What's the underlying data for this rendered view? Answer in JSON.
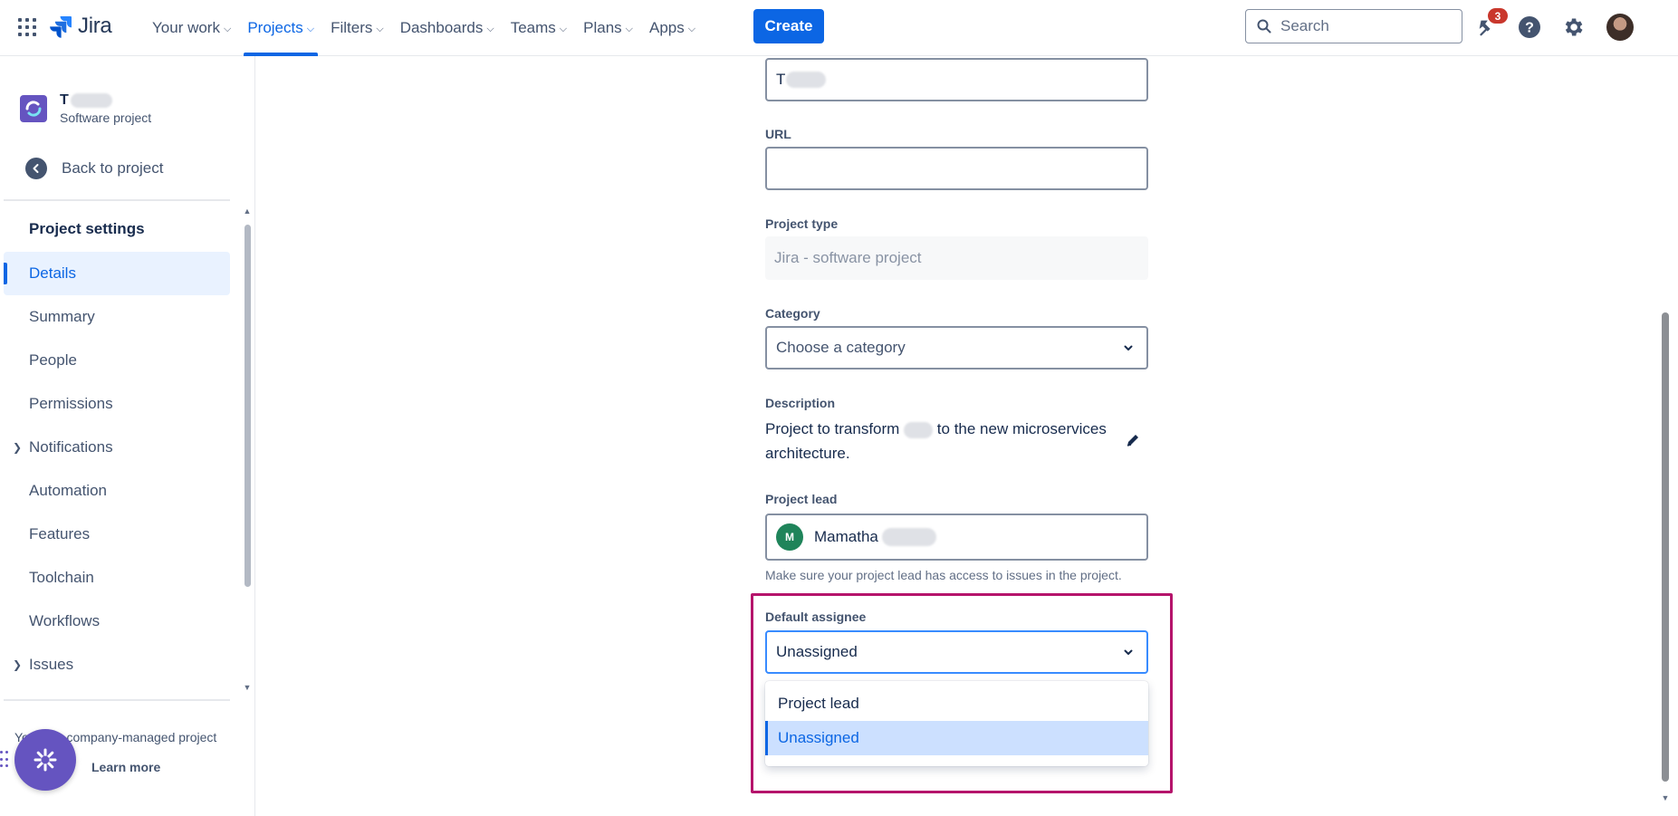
{
  "topbar": {
    "logo_text": "Jira",
    "nav": [
      {
        "label": "Your work",
        "active": false
      },
      {
        "label": "Projects",
        "active": true
      },
      {
        "label": "Filters",
        "active": false
      },
      {
        "label": "Dashboards",
        "active": false
      },
      {
        "label": "Teams",
        "active": false
      },
      {
        "label": "Plans",
        "active": false
      },
      {
        "label": "Apps",
        "active": false
      }
    ],
    "create_label": "Create",
    "search_placeholder": "Search",
    "notification_count": "3",
    "colors": {
      "accent": "#0c66e4",
      "badge": "#c9372c"
    },
    "icons": [
      "app-switcher-icon",
      "search-icon",
      "notification-icon",
      "help-icon",
      "settings-icon"
    ]
  },
  "sidebar": {
    "project_name": "T",
    "project_type": "Software project",
    "back_label": "Back to project",
    "section_title": "Project settings",
    "items": [
      {
        "label": "Details",
        "selected": true,
        "expandable": false
      },
      {
        "label": "Summary",
        "selected": false,
        "expandable": false
      },
      {
        "label": "People",
        "selected": false,
        "expandable": false
      },
      {
        "label": "Permissions",
        "selected": false,
        "expandable": false
      },
      {
        "label": "Notifications",
        "selected": false,
        "expandable": true
      },
      {
        "label": "Automation",
        "selected": false,
        "expandable": false
      },
      {
        "label": "Features",
        "selected": false,
        "expandable": false
      },
      {
        "label": "Toolchain",
        "selected": false,
        "expandable": false
      },
      {
        "label": "Workflows",
        "selected": false,
        "expandable": false
      },
      {
        "label": "Issues",
        "selected": false,
        "expandable": true
      }
    ],
    "footer_prefix": "Yo",
    "footer_suffix": "a company-managed project",
    "learn_more": "Learn more"
  },
  "form": {
    "name_value": "T",
    "url_label": "URL",
    "url_value": "",
    "project_type_label": "Project type",
    "project_type_value": "Jira - software project",
    "category_label": "Category",
    "category_placeholder": "Choose a category",
    "description_label": "Description",
    "description_part1": "Project to transform",
    "description_part2": "to the new microservices architecture.",
    "lead_label": "Project lead",
    "lead_initials": "M",
    "lead_name": "Mamatha",
    "lead_helper": "Make sure your project lead has access to issues in the project.",
    "assignee_label": "Default assignee",
    "assignee_value": "Unassigned",
    "assignee_options": [
      {
        "label": "Project lead",
        "selected": false
      },
      {
        "label": "Unassigned",
        "selected": true
      }
    ],
    "highlight_color": "#b5146b"
  }
}
